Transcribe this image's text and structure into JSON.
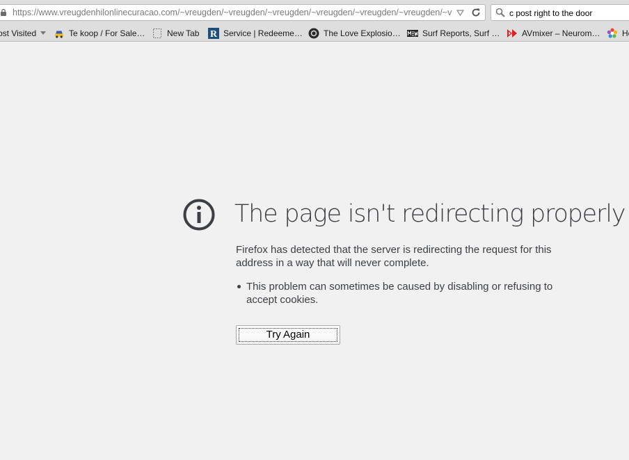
{
  "navbar": {
    "url_host": "https://www.vreugdenhilonlinecuracao.com",
    "url_path": "/~vreugden/~vreugden/~vreugden/~vreugden/~vreugden/~vreugden/~vre",
    "search_value": "c post right to the door"
  },
  "bookmarks": [
    {
      "label": "ost Visited",
      "icon": "dropdown-caret"
    },
    {
      "label": "Te koop / For Sale…",
      "icon": "car-icon"
    },
    {
      "label": "New Tab",
      "icon": "blank-page-icon"
    },
    {
      "label": "Service | Redeeme…",
      "icon": "r-logo-icon"
    },
    {
      "label": "The Love Explosio…",
      "icon": "circle-logo-icon"
    },
    {
      "label": "Surf Reports, Surf …",
      "icon": "msw-logo-icon"
    },
    {
      "label": "AVmixer – Neurom…",
      "icon": "avmixer-logo-icon"
    },
    {
      "label": "He",
      "icon": "flower-logo-icon"
    }
  ],
  "error": {
    "title": "The page isn't redirecting properly",
    "description": "Firefox has detected that the server is redirecting the request for this address in a way that will never complete.",
    "bullets": [
      "This problem can sometimes be caused by disabling or refusing to accept cookies."
    ],
    "button_label": "Try Again"
  },
  "colors": {
    "page_background": "#f1f1f1",
    "text": "#3c4045",
    "toolbar": "#dedede"
  }
}
